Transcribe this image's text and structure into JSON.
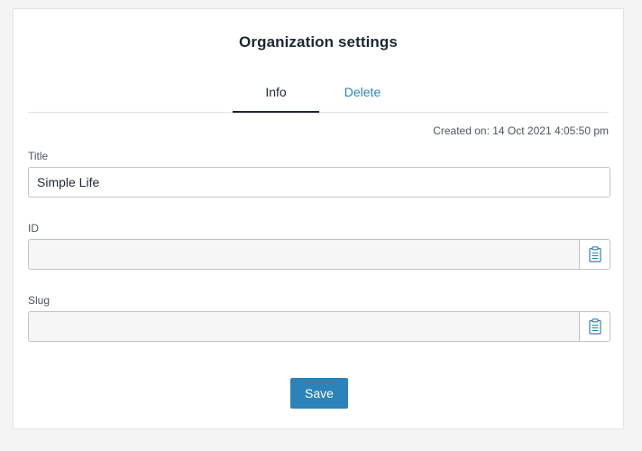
{
  "header": {
    "title": "Organization settings"
  },
  "tabs": [
    {
      "label": "Info",
      "active": true
    },
    {
      "label": "Delete",
      "active": false
    }
  ],
  "meta": {
    "created": "Created on: 14 Oct 2021 4:05:50 pm"
  },
  "form": {
    "title": {
      "label": "Title",
      "value": "Simple Life"
    },
    "id": {
      "label": "ID",
      "value": ""
    },
    "slug": {
      "label": "Slug",
      "value": ""
    }
  },
  "actions": {
    "save_label": "Save"
  },
  "icons": {
    "copy": "clipboard-icon"
  },
  "colors": {
    "accent": "#2c83b9",
    "text": "#1c2733"
  }
}
